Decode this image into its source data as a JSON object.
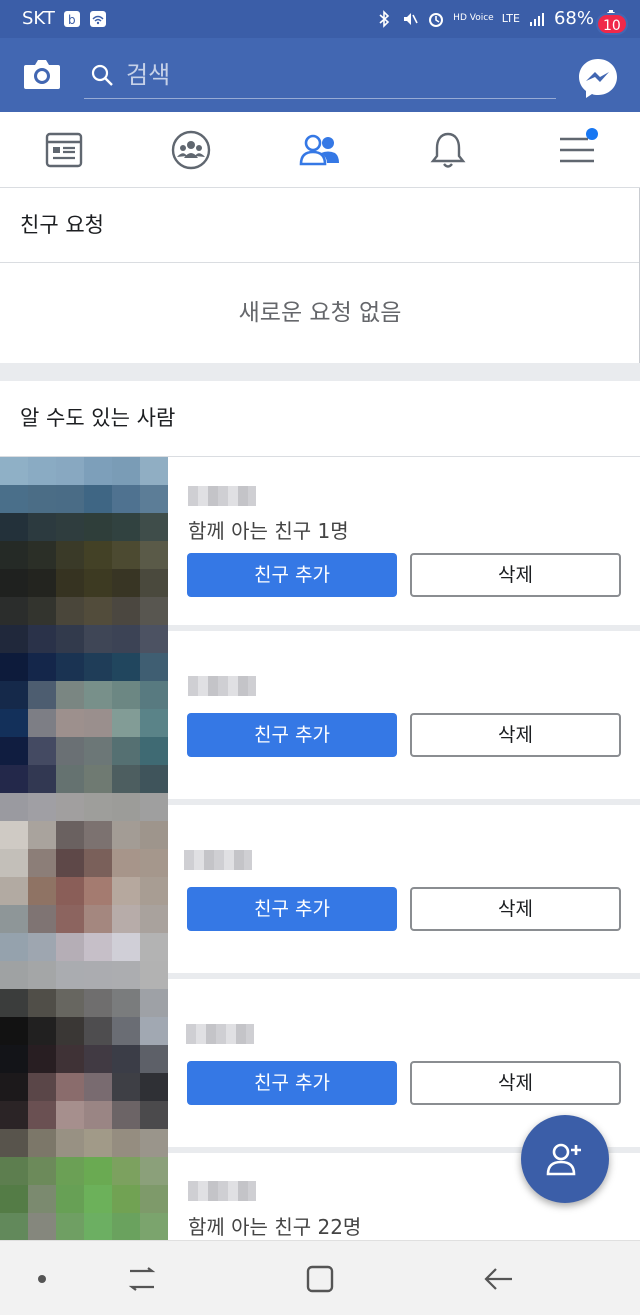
{
  "status_bar": {
    "carrier": "SKT",
    "battery_percent": "68%",
    "network": "LTE",
    "volte": "HD Voice"
  },
  "app_bar": {
    "search_placeholder": "검색",
    "messenger_badge": "10"
  },
  "tabs": [
    "news-feed",
    "groups",
    "friends",
    "notifications",
    "menu"
  ],
  "friend_requests": {
    "title": "친구 요청",
    "empty_text": "새로운 요청 없음"
  },
  "people_you_may_know": {
    "title": "알 수도 있는 사람",
    "people": [
      {
        "mutual": "함께 아는 친구 1명",
        "add_label": "친구 추가",
        "delete_label": "삭제"
      },
      {
        "mutual": "",
        "add_label": "친구 추가",
        "delete_label": "삭제"
      },
      {
        "mutual": "",
        "add_label": "친구 추가",
        "delete_label": "삭제"
      },
      {
        "mutual": "",
        "add_label": "친구 추가",
        "delete_label": "삭제"
      },
      {
        "mutual": "함께 아는 친구 22명",
        "add_label": "",
        "delete_label": ""
      }
    ]
  },
  "colors": {
    "brand": "#4267b2",
    "status_bar": "#3b5ea8",
    "add_button": "#3578e5",
    "badge": "#f02849"
  }
}
